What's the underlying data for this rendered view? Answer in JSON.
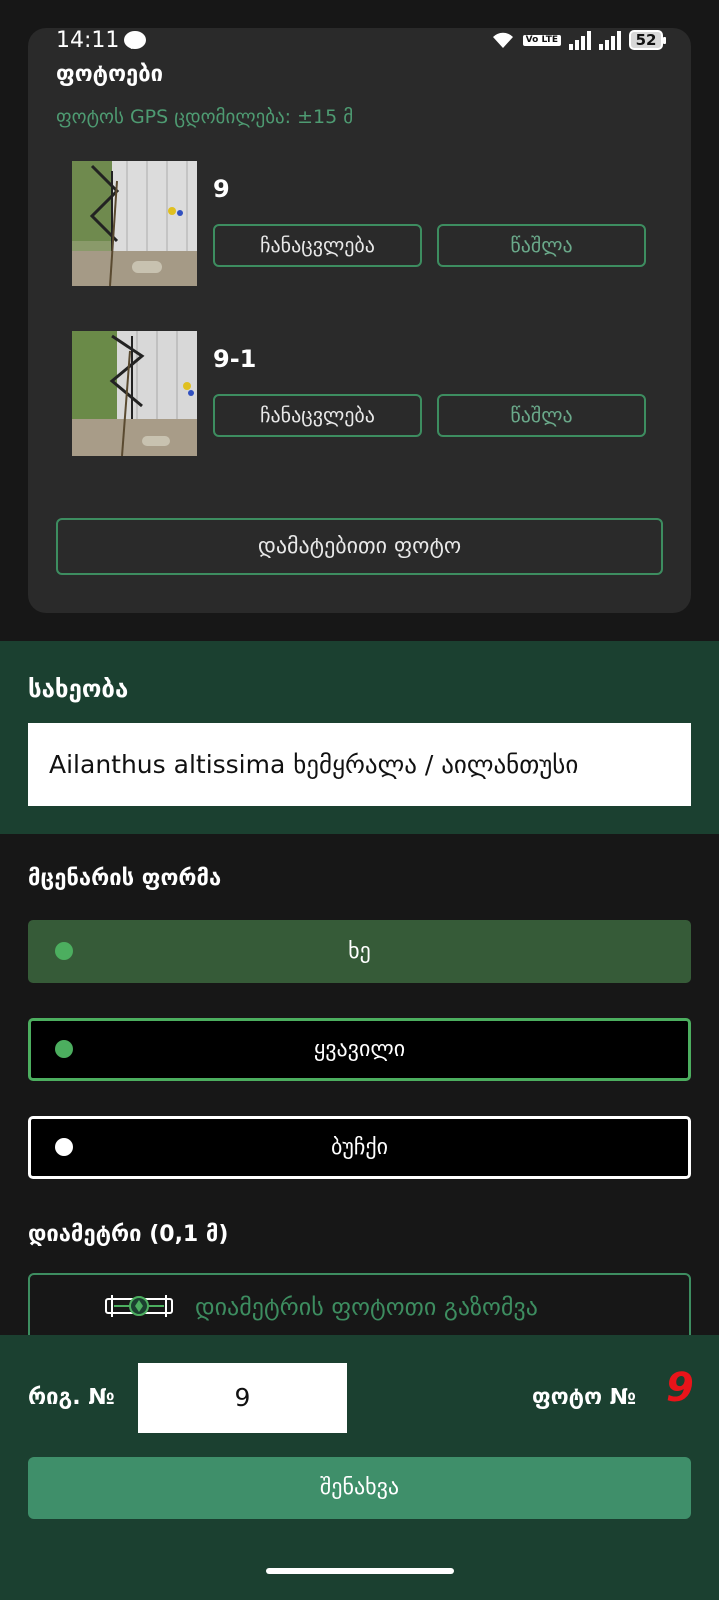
{
  "status_bar": {
    "time": "14:11",
    "volte": "Vo LTE",
    "battery": "52"
  },
  "photos_card": {
    "title": "ფოტოები",
    "gps_accuracy": "ფოტოს GPS ცდომილება: ±15 მ",
    "photos": [
      {
        "name": "9",
        "replace_label": "ჩანაცვლება",
        "delete_label": "წაშლა"
      },
      {
        "name": "9-1",
        "replace_label": "ჩანაცვლება",
        "delete_label": "წაშლა"
      }
    ],
    "add_photo_label": "დამატებითი ფოტო"
  },
  "species": {
    "label": "სახეობა",
    "value": "Ailanthus altissima ხემყრალა / აილანთუსი"
  },
  "plant_form": {
    "label": "მცენარის ფორმა",
    "options": [
      {
        "label": "ხე",
        "selected": true
      },
      {
        "label": "ყვავილი",
        "selected": false
      },
      {
        "label": "ბუჩქი",
        "selected": false
      }
    ]
  },
  "diameter": {
    "label": "დიამეტრი (0,1 მ)",
    "measure_button_label": "დიამეტრის ფოტოთი გაზომვა"
  },
  "bottom_bar": {
    "row_no_label": "რიგ. №",
    "row_no_value": "9",
    "photo_no_label": "ფოტო №",
    "photo_no_value": "9",
    "save_label": "შენახვა"
  },
  "colors": {
    "accent_green": "#3d8d60",
    "band_green": "#1b4030",
    "selected_option": "#365b38",
    "photo_no_red": "#e8141a"
  }
}
